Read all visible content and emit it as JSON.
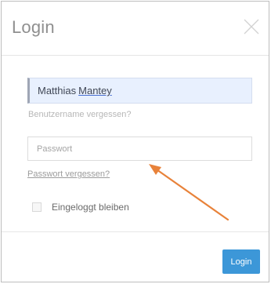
{
  "dialog": {
    "title": "Login",
    "close_icon": "close-icon"
  },
  "form": {
    "username_first": "Matthias",
    "username_last": "Mantey",
    "forgot_username": "Benutzername vergessen?",
    "password_placeholder": "Passwort",
    "forgot_password": "Passwort vergessen?",
    "remember_label": "Eingeloggt bleiben",
    "remember_checked": false
  },
  "footer": {
    "login_label": "Login"
  },
  "colors": {
    "accent": "#3c97d8",
    "annotation_arrow": "#e8823a",
    "autofill_bg": "#e8f0fe"
  },
  "annotation": {
    "type": "arrow",
    "points_to": "forgot-password-link"
  }
}
